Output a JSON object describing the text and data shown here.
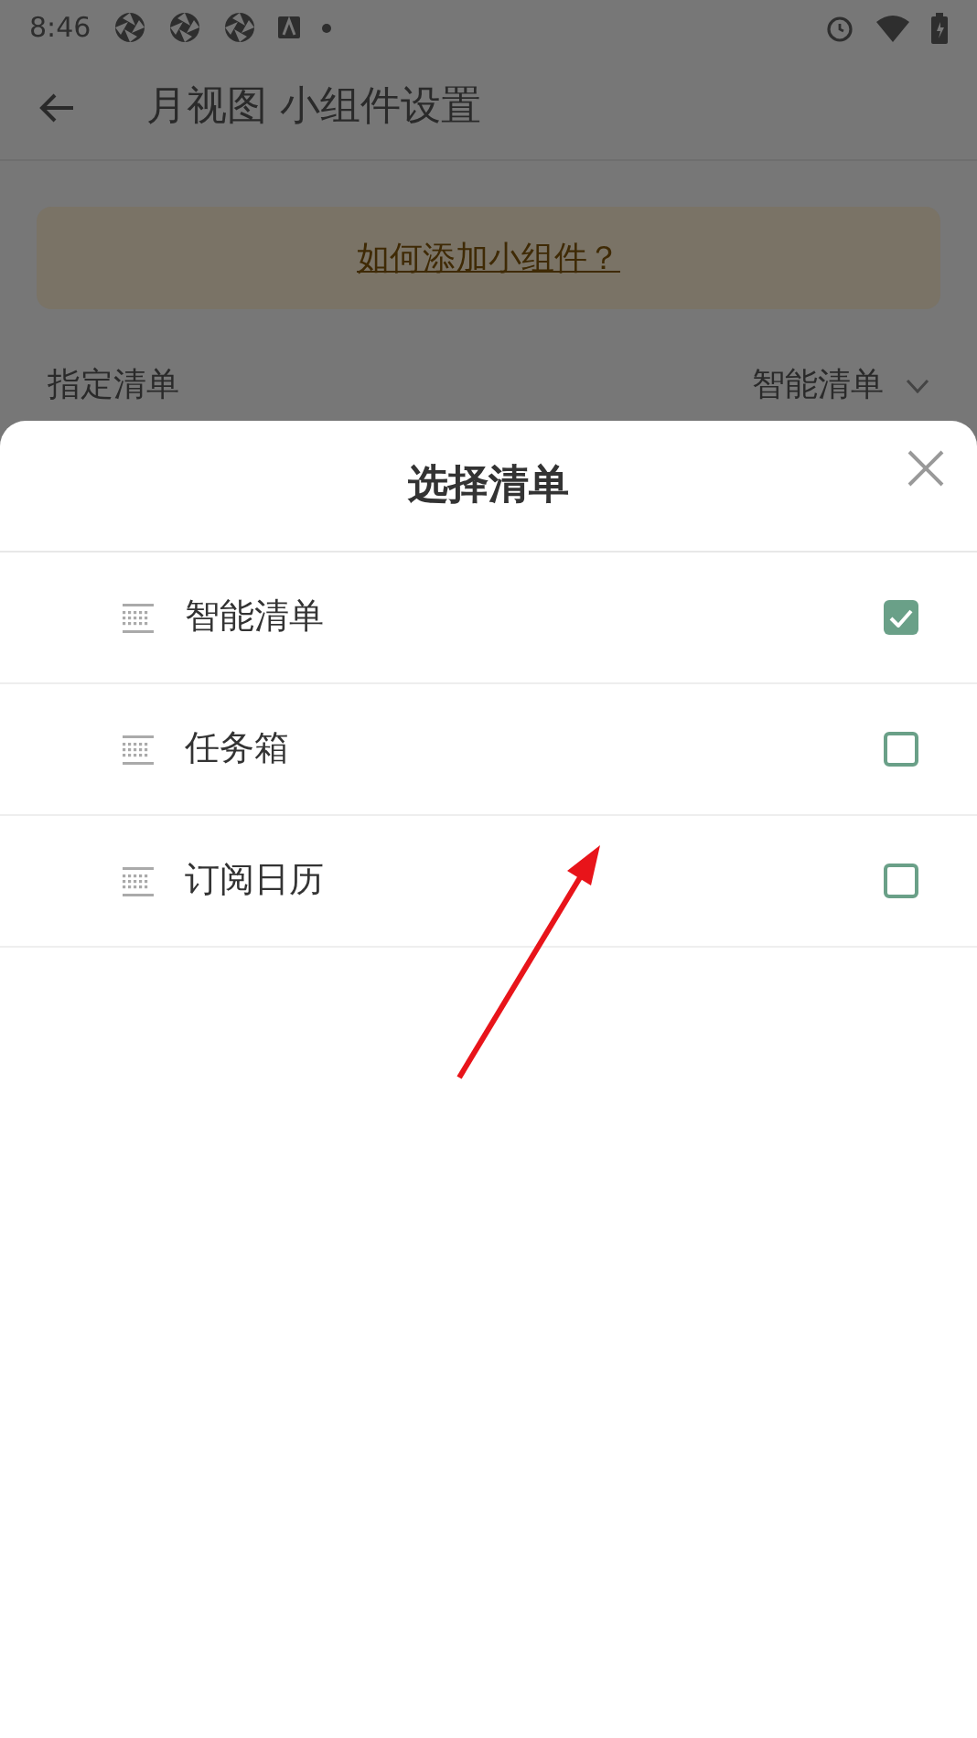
{
  "status_bar": {
    "time": "8:46"
  },
  "header": {
    "title": "月视图 小组件设置"
  },
  "help_link": "如何添加小组件？",
  "setting_row": {
    "label": "指定清单",
    "value": "智能清单"
  },
  "sheet": {
    "title": "选择清单",
    "items": [
      {
        "label": "智能清单",
        "checked": true
      },
      {
        "label": "任务箱",
        "checked": false
      },
      {
        "label": "订阅日历",
        "checked": false
      }
    ]
  }
}
